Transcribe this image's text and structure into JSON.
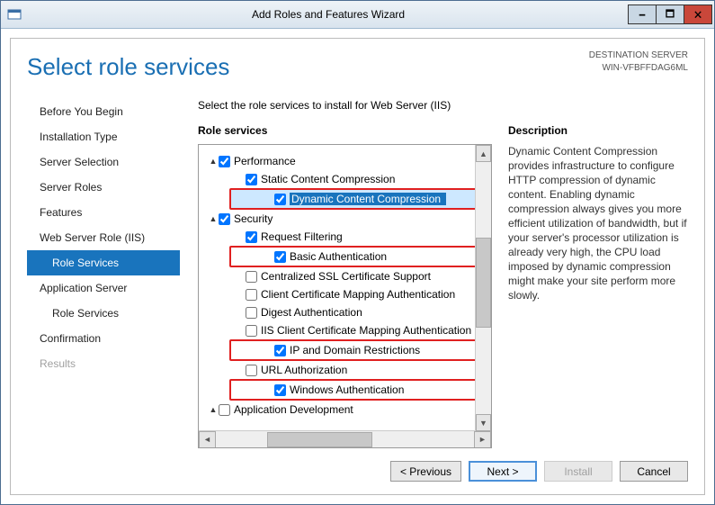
{
  "window": {
    "title": "Add Roles and Features Wizard"
  },
  "header": {
    "page_title": "Select role services",
    "dest_label": "DESTINATION SERVER",
    "dest_server": "WIN-VFBFFDAG6ML"
  },
  "nav": {
    "items": [
      {
        "label": "Before You Begin",
        "indent": false,
        "selected": false
      },
      {
        "label": "Installation Type",
        "indent": false,
        "selected": false
      },
      {
        "label": "Server Selection",
        "indent": false,
        "selected": false
      },
      {
        "label": "Server Roles",
        "indent": false,
        "selected": false
      },
      {
        "label": "Features",
        "indent": false,
        "selected": false
      },
      {
        "label": "Web Server Role (IIS)",
        "indent": false,
        "selected": false
      },
      {
        "label": "Role Services",
        "indent": true,
        "selected": true
      },
      {
        "label": "Application Server",
        "indent": false,
        "selected": false
      },
      {
        "label": "Role Services",
        "indent": true,
        "selected": false
      },
      {
        "label": "Confirmation",
        "indent": false,
        "selected": false
      },
      {
        "label": "Results",
        "indent": false,
        "selected": false,
        "disabled": true
      }
    ]
  },
  "main": {
    "instruction": "Select the role services to install for Web Server (IIS)",
    "tree_label": "Role services",
    "desc_label": "Description",
    "description": "Dynamic Content Compression provides infrastructure to configure HTTP compression of dynamic content. Enabling dynamic compression always gives you more efficient utilization of bandwidth, but if your server's processor utilization is already very high, the CPU load imposed by dynamic compression might make your site perform more slowly."
  },
  "tree": {
    "items": [
      {
        "level": 0,
        "expander": "▲",
        "checked": true,
        "label": "Performance"
      },
      {
        "level": 1,
        "expander": "",
        "checked": true,
        "label": "Static Content Compression"
      },
      {
        "level": 1,
        "expander": "",
        "checked": true,
        "label": "Dynamic Content Compression",
        "selected": true,
        "highlight": true
      },
      {
        "level": 0,
        "expander": "▲",
        "checked": true,
        "label": "Security"
      },
      {
        "level": 1,
        "expander": "",
        "checked": true,
        "label": "Request Filtering"
      },
      {
        "level": 1,
        "expander": "",
        "checked": true,
        "label": "Basic Authentication",
        "highlight": true
      },
      {
        "level": 1,
        "expander": "",
        "checked": false,
        "label": "Centralized SSL Certificate Support"
      },
      {
        "level": 1,
        "expander": "",
        "checked": false,
        "label": "Client Certificate Mapping Authentication"
      },
      {
        "level": 1,
        "expander": "",
        "checked": false,
        "label": "Digest Authentication"
      },
      {
        "level": 1,
        "expander": "",
        "checked": false,
        "label": "IIS Client Certificate Mapping Authentication"
      },
      {
        "level": 1,
        "expander": "",
        "checked": true,
        "label": "IP and Domain Restrictions",
        "highlight": true
      },
      {
        "level": 1,
        "expander": "",
        "checked": false,
        "label": "URL Authorization"
      },
      {
        "level": 1,
        "expander": "",
        "checked": true,
        "label": "Windows Authentication",
        "highlight": true
      },
      {
        "level": 0,
        "expander": "▲",
        "checked": false,
        "label": "Application Development"
      }
    ]
  },
  "footer": {
    "previous": "< Previous",
    "next": "Next >",
    "install": "Install",
    "cancel": "Cancel"
  }
}
